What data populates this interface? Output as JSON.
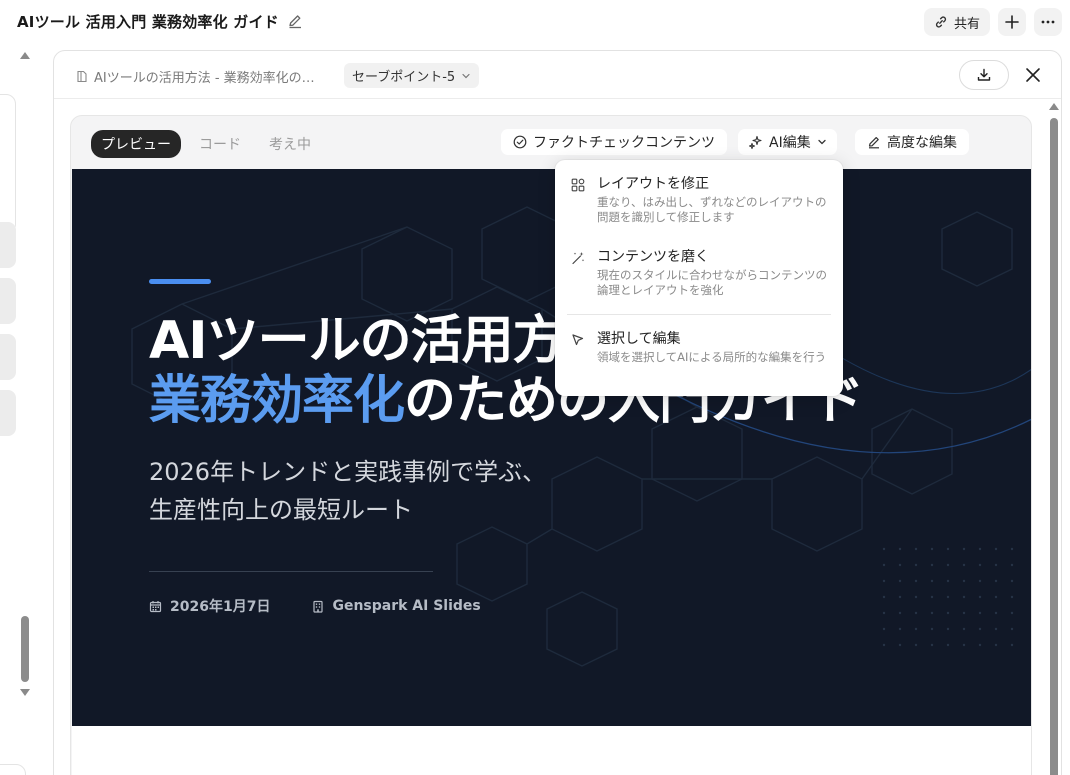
{
  "header": {
    "doc_title": "AIツール 活用入門 業務効率化 ガイド",
    "share_label": "共有",
    "edit_icon": "pencil-icon",
    "plus_icon": "plus-icon",
    "more_icon": "ellipsis-icon"
  },
  "panel": {
    "file_name": "AIツールの活用方法 - 業務効率化の…",
    "savepoint": "セーブポイント-5"
  },
  "toolbar": {
    "tabs": [
      "プレビュー",
      "コード",
      "考え中"
    ],
    "fact_check": "ファクトチェックコンテンツ",
    "ai_edit": "AI編集",
    "advanced_edit": "高度な編集"
  },
  "dropdown": {
    "items": [
      {
        "title": "レイアウトを修正",
        "desc": "重なり、はみ出し、ずれなどのレイアウトの問題を識別して修正します",
        "icon": "layout-grid-icon"
      },
      {
        "title": "コンテンツを磨く",
        "desc": "現在のスタイルに合わせながらコンテンツの論理とレイアウトを強化",
        "icon": "magic-wand-icon"
      },
      {
        "title": "選択して編集",
        "desc": "領域を選択してAIによる局所的な編集を行う",
        "icon": "cursor-select-icon"
      }
    ]
  },
  "slide": {
    "title_line1": "AIツールの活用方法",
    "title_line2_highlight": "業務効率化",
    "title_line2_rest": "のための入門ガイド",
    "subtitle_line1": "2026年トレンドと実践事例で学ぶ、",
    "subtitle_line2": "生産性向上の最短ルート",
    "date": "2026年1月7日",
    "author": "Genspark AI Slides"
  },
  "colors": {
    "slide_bg": "#111827",
    "accent": "#4a8ef0",
    "highlight_text": "#5b9cf0"
  }
}
